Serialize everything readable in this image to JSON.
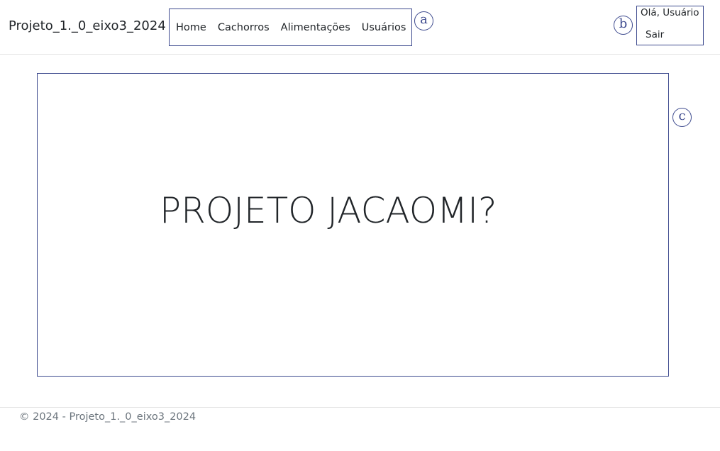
{
  "header": {
    "brand": "Projeto_1._0_eixo3_2024",
    "nav": [
      {
        "label": "Home"
      },
      {
        "label": "Cachorros"
      },
      {
        "label": "Alimentações"
      },
      {
        "label": "Usuários"
      }
    ],
    "user": {
      "greeting": "Olá, Usuário",
      "logout_label": "Sair"
    }
  },
  "annotations": {
    "a": "a",
    "b": "b",
    "c": "c"
  },
  "main": {
    "title": "PROJETO JACAOMI?"
  },
  "footer": {
    "text": "© 2024 - Projeto_1._0_eixo3_2024"
  },
  "colors": {
    "annotation": "#3d4a8e",
    "text": "#212529",
    "muted": "#6c757d",
    "divider": "#e5e5e5"
  }
}
